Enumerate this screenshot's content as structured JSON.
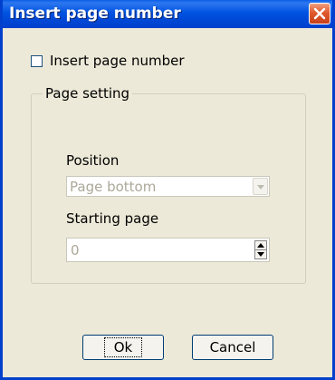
{
  "window": {
    "title": "Insert page number"
  },
  "options": {
    "insert_page_number_label": "Insert page number",
    "insert_page_number_checked": false
  },
  "page_setting": {
    "legend": "Page setting",
    "position_label": "Position",
    "position_value": "Page bottom",
    "starting_page_label": "Starting page",
    "starting_page_value": "0"
  },
  "buttons": {
    "ok_label": "Ok",
    "cancel_label": "Cancel"
  },
  "icons": {
    "close": "close-icon",
    "dropdown": "chevron-down-icon",
    "spin_up": "spin-up-icon",
    "spin_down": "spin-down-icon"
  },
  "colors": {
    "titlebar": "#0053E1",
    "close_button": "#E05A2E",
    "dialog_background": "#ECE9D8",
    "disabled_text": "#ACA899"
  }
}
